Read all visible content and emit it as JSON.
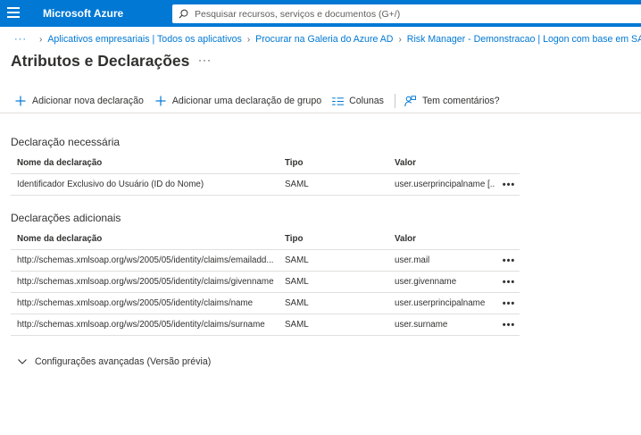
{
  "topbar": {
    "brand": "Microsoft Azure",
    "search_placeholder": "Pesquisar recursos, serviços e documentos (G+/)",
    "accent": "#0078d4"
  },
  "breadcrumb": {
    "overflow": "···",
    "items": [
      "Aplicativos empresariais | Todos os aplicativos",
      "Procurar na Galeria do Azure AD",
      "Risk Manager - Demonstracao | Logon com base em SAML"
    ]
  },
  "page": {
    "title": "Atributos e Declarações",
    "more": "···"
  },
  "toolbar": {
    "add_claim": "Adicionar nova declaração",
    "add_group_claim": "Adicionar uma declaração de grupo",
    "columns": "Colunas",
    "feedback": "Tem comentários?"
  },
  "required": {
    "title": "Declaração necessária",
    "headers": {
      "name": "Nome da declaração",
      "type": "Tipo",
      "value": "Valor"
    },
    "rows": [
      {
        "name": "Identificador Exclusivo do Usuário (ID do Nome)",
        "type": "SAML",
        "value": "user.userprincipalname [..."
      }
    ]
  },
  "additional": {
    "title": "Declarações adicionais",
    "headers": {
      "name": "Nome da declaração",
      "type": "Tipo",
      "value": "Valor"
    },
    "rows": [
      {
        "name": "http://schemas.xmlsoap.org/ws/2005/05/identity/claims/emailadd...",
        "type": "SAML",
        "value": "user.mail"
      },
      {
        "name": "http://schemas.xmlsoap.org/ws/2005/05/identity/claims/givenname",
        "type": "SAML",
        "value": "user.givenname"
      },
      {
        "name": "http://schemas.xmlsoap.org/ws/2005/05/identity/claims/name",
        "type": "SAML",
        "value": "user.userprincipalname"
      },
      {
        "name": "http://schemas.xmlsoap.org/ws/2005/05/identity/claims/surname",
        "type": "SAML",
        "value": "user.surname"
      }
    ]
  },
  "row_more": "•••",
  "advanced": {
    "label": "Configurações avançadas (Versão prévia)"
  }
}
